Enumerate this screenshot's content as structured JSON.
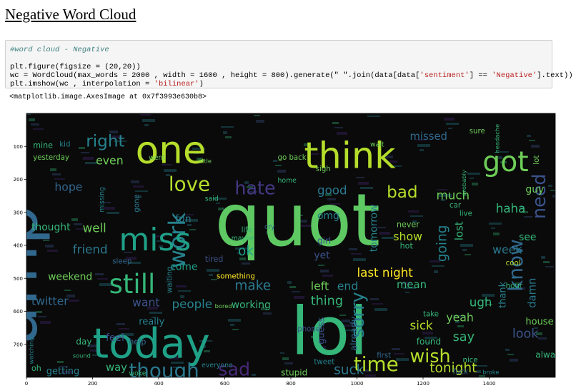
{
  "notebook": {
    "title": "Negative Word Cloud",
    "code_lines": [
      {
        "kind": "comment",
        "parts": [
          {
            "t": "#word cloud - Negative",
            "c": "comment"
          }
        ]
      },
      {
        "kind": "blank",
        "parts": [
          {
            "t": "",
            "c": ""
          }
        ]
      },
      {
        "kind": "code",
        "parts": [
          {
            "t": "plt.figure(figsize = (20,20))",
            "c": ""
          }
        ]
      },
      {
        "kind": "code",
        "parts": [
          {
            "t": "wc = WordCloud(max_words = 2000 , width = 1600 , height = 800).generate(\" \".join(data[data[",
            "c": ""
          },
          {
            "t": "'sentiment'",
            "c": "str"
          },
          {
            "t": "] == ",
            "c": ""
          },
          {
            "t": "'Negative'",
            "c": "str"
          },
          {
            "t": "].text))",
            "c": ""
          }
        ]
      },
      {
        "kind": "code",
        "parts": [
          {
            "t": "plt.imshow(wc , interpolation = ",
            "c": ""
          },
          {
            "t": "'bilinear'",
            "c": "str"
          },
          {
            "t": ")",
            "c": ""
          }
        ]
      }
    ],
    "output_repr": "<matplotlib.image.AxesImage at 0x7f3993e630b8>"
  },
  "chart_data": {
    "type": "word-cloud-image",
    "x_ticks": [
      0,
      200,
      400,
      600,
      800,
      1000,
      1200,
      1400
    ],
    "y_ticks": [
      100,
      200,
      300,
      400,
      500,
      600,
      700
    ],
    "xlim": [
      0,
      1600
    ],
    "ylim": [
      800,
      0
    ],
    "background": "#0a0a0a",
    "words": [
      {
        "text": "quot",
        "x": 570,
        "y": 400,
        "size": 220,
        "color": "#5ec962",
        "rot": 0
      },
      {
        "text": "amp",
        "x": 30,
        "y": 700,
        "size": 190,
        "color": "#31688e",
        "rot": -90
      },
      {
        "text": "lol",
        "x": 800,
        "y": 730,
        "size": 200,
        "color": "#35b779",
        "rot": 0
      },
      {
        "text": "one",
        "x": 330,
        "y": 150,
        "size": 115,
        "color": "#b5de2b",
        "rot": 0
      },
      {
        "text": "think",
        "x": 840,
        "y": 165,
        "size": 110,
        "color": "#b5de2b",
        "rot": 0
      },
      {
        "text": "today",
        "x": 200,
        "y": 740,
        "size": 125,
        "color": "#1fa187",
        "rot": 0
      },
      {
        "text": "got",
        "x": 1380,
        "y": 175,
        "size": 85,
        "color": "#6ece58",
        "rot": 0
      },
      {
        "text": "work",
        "x": 480,
        "y": 470,
        "size": 70,
        "color": "#26828e",
        "rot": -90
      },
      {
        "text": "miss",
        "x": 280,
        "y": 415,
        "size": 95,
        "color": "#1fa187",
        "rot": 0
      },
      {
        "text": "still",
        "x": 250,
        "y": 545,
        "size": 80,
        "color": "#35b779",
        "rot": 0
      },
      {
        "text": "love",
        "x": 430,
        "y": 235,
        "size": 60,
        "color": "#b5de2b",
        "rot": 0
      },
      {
        "text": "hate",
        "x": 630,
        "y": 245,
        "size": 55,
        "color": "#443983",
        "rot": 0
      },
      {
        "text": "though",
        "x": 310,
        "y": 800,
        "size": 60,
        "color": "#2a788e",
        "rot": 0
      },
      {
        "text": "sad",
        "x": 580,
        "y": 795,
        "size": 55,
        "color": "#482878",
        "rot": 0
      },
      {
        "text": "time",
        "x": 990,
        "y": 780,
        "size": 60,
        "color": "#b5de2b",
        "rot": 0
      },
      {
        "text": "wish",
        "x": 1160,
        "y": 755,
        "size": 55,
        "color": "#b5de2b",
        "rot": 0
      },
      {
        "text": "know",
        "x": 1500,
        "y": 540,
        "size": 60,
        "color": "#31688e",
        "rot": -90
      },
      {
        "text": "need",
        "x": 1570,
        "y": 320,
        "size": 55,
        "color": "#3b528b",
        "rot": -90
      },
      {
        "text": "bad",
        "x": 1090,
        "y": 255,
        "size": 50,
        "color": "#b5de2b",
        "rot": 0
      },
      {
        "text": "right",
        "x": 180,
        "y": 100,
        "size": 50,
        "color": "#26828e",
        "rot": 0
      },
      {
        "text": "sorry",
        "x": 1020,
        "y": 680,
        "size": 55,
        "color": "#26828e",
        "rot": -90
      },
      {
        "text": "last night",
        "x": 1000,
        "y": 495,
        "size": 36,
        "color": "#fde725",
        "rot": 0
      },
      {
        "text": "tonight",
        "x": 1220,
        "y": 785,
        "size": 40,
        "color": "#b5de2b",
        "rot": 0
      },
      {
        "text": "suck",
        "x": 930,
        "y": 790,
        "size": 40,
        "color": "#2a788e",
        "rot": 0
      },
      {
        "text": "good",
        "x": 880,
        "y": 245,
        "size": 36,
        "color": "#2a788e",
        "rot": 0
      },
      {
        "text": "much",
        "x": 1240,
        "y": 260,
        "size": 36,
        "color": "#6ece58",
        "rot": 0
      },
      {
        "text": "haha",
        "x": 1420,
        "y": 300,
        "size": 36,
        "color": "#35b779",
        "rot": 0
      },
      {
        "text": "well",
        "x": 170,
        "y": 360,
        "size": 36,
        "color": "#6ece58",
        "rot": 0
      },
      {
        "text": "friend",
        "x": 140,
        "y": 425,
        "size": 36,
        "color": "#2a788e",
        "rot": 0
      },
      {
        "text": "weekend",
        "x": 65,
        "y": 505,
        "size": 30,
        "color": "#6ece58",
        "rot": 0
      },
      {
        "text": "twitter",
        "x": 15,
        "y": 580,
        "size": 34,
        "color": "#31688e",
        "rot": 0
      },
      {
        "text": "people",
        "x": 440,
        "y": 590,
        "size": 36,
        "color": "#26828e",
        "rot": 0
      },
      {
        "text": "make",
        "x": 630,
        "y": 535,
        "size": 40,
        "color": "#2a788e",
        "rot": 0
      },
      {
        "text": "ok",
        "x": 640,
        "y": 430,
        "size": 40,
        "color": "#1fa187",
        "rot": 0
      },
      {
        "text": "want",
        "x": 320,
        "y": 585,
        "size": 34,
        "color": "#3b528b",
        "rot": 0
      },
      {
        "text": "working",
        "x": 620,
        "y": 590,
        "size": 30,
        "color": "#35b779",
        "rot": 0
      },
      {
        "text": "thing",
        "x": 860,
        "y": 580,
        "size": 38,
        "color": "#35b779",
        "rot": 0
      },
      {
        "text": "left",
        "x": 860,
        "y": 535,
        "size": 34,
        "color": "#6ece58",
        "rot": 0
      },
      {
        "text": "end",
        "x": 940,
        "y": 535,
        "size": 34,
        "color": "#26828e",
        "rot": 0
      },
      {
        "text": "show",
        "x": 1110,
        "y": 385,
        "size": 34,
        "color": "#b5de2b",
        "rot": 0
      },
      {
        "text": "going",
        "x": 1270,
        "y": 450,
        "size": 40,
        "color": "#26828e",
        "rot": -90
      },
      {
        "text": "lost",
        "x": 1320,
        "y": 385,
        "size": 32,
        "color": "#35b779",
        "rot": -90
      },
      {
        "text": "tomorrow",
        "x": 1060,
        "y": 420,
        "size": 30,
        "color": "#26828e",
        "rot": -90
      },
      {
        "text": "look",
        "x": 1470,
        "y": 680,
        "size": 38,
        "color": "#3b528b",
        "rot": 0
      },
      {
        "text": "say",
        "x": 1290,
        "y": 690,
        "size": 38,
        "color": "#35b779",
        "rot": 0
      },
      {
        "text": "yeah",
        "x": 1270,
        "y": 630,
        "size": 34,
        "color": "#6ece58",
        "rot": 0
      },
      {
        "text": "sick",
        "x": 1160,
        "y": 655,
        "size": 36,
        "color": "#b5de2b",
        "rot": 0
      },
      {
        "text": "ugh",
        "x": 1340,
        "y": 585,
        "size": 36,
        "color": "#35b779",
        "rot": 0
      },
      {
        "text": "mean",
        "x": 1120,
        "y": 530,
        "size": 32,
        "color": "#35b779",
        "rot": 0
      },
      {
        "text": "guy",
        "x": 1510,
        "y": 240,
        "size": 30,
        "color": "#6ece58",
        "rot": 0
      },
      {
        "text": "week",
        "x": 1410,
        "y": 425,
        "size": 34,
        "color": "#2a788e",
        "rot": 0
      },
      {
        "text": "damn",
        "x": 1540,
        "y": 590,
        "size": 32,
        "color": "#2a788e",
        "rot": -90
      },
      {
        "text": "house",
        "x": 1510,
        "y": 640,
        "size": 28,
        "color": "#6ece58",
        "rot": 0
      },
      {
        "text": "even",
        "x": 210,
        "y": 155,
        "size": 34,
        "color": "#6ece58",
        "rot": 0
      },
      {
        "text": "hope",
        "x": 85,
        "y": 235,
        "size": 34,
        "color": "#31688e",
        "rot": 0
      },
      {
        "text": "thought",
        "x": 15,
        "y": 355,
        "size": 30,
        "color": "#35b779",
        "rot": 0
      },
      {
        "text": "missed",
        "x": 1160,
        "y": 80,
        "size": 32,
        "color": "#31688e",
        "rot": 0
      },
      {
        "text": "way",
        "x": 240,
        "y": 780,
        "size": 32,
        "color": "#35b779",
        "rot": 0
      },
      {
        "text": "getting",
        "x": 60,
        "y": 790,
        "size": 28,
        "color": "#26828e",
        "rot": 0
      },
      {
        "text": "stupid",
        "x": 770,
        "y": 795,
        "size": 26,
        "color": "#6ece58",
        "rot": 0
      },
      {
        "text": "really",
        "x": 340,
        "y": 640,
        "size": 28,
        "color": "#26828e",
        "rot": 0
      },
      {
        "text": "guess",
        "x": 900,
        "y": 700,
        "size": 28,
        "color": "#3b528b",
        "rot": -90
      },
      {
        "text": "already",
        "x": 1000,
        "y": 720,
        "size": 28,
        "color": "#31688e",
        "rot": -90
      },
      {
        "text": "found",
        "x": 1180,
        "y": 700,
        "size": 26,
        "color": "#35b779",
        "rot": 0
      },
      {
        "text": "feel",
        "x": 240,
        "y": 690,
        "size": 30,
        "color": "#3b528b",
        "rot": 0
      },
      {
        "text": "come",
        "x": 435,
        "y": 475,
        "size": 30,
        "color": "#1fa187",
        "rot": 0
      },
      {
        "text": "something",
        "x": 575,
        "y": 500,
        "size": 22,
        "color": "#fde725",
        "rot": 0
      },
      {
        "text": "see",
        "x": 1490,
        "y": 385,
        "size": 30,
        "color": "#35b779",
        "rot": 0
      },
      {
        "text": "alway",
        "x": 1540,
        "y": 740,
        "size": 26,
        "color": "#35b779",
        "rot": 0
      },
      {
        "text": "thank",
        "x": 1450,
        "y": 590,
        "size": 28,
        "color": "#26828e",
        "rot": -90
      },
      {
        "text": "fun",
        "x": 450,
        "y": 330,
        "size": 30,
        "color": "#2a788e",
        "rot": 0
      },
      {
        "text": "waiting",
        "x": 440,
        "y": 545,
        "size": 22,
        "color": "#26828e",
        "rot": -90
      },
      {
        "text": "day",
        "x": 150,
        "y": 700,
        "size": 26,
        "color": "#35b779",
        "rot": 0
      },
      {
        "text": "sound",
        "x": 140,
        "y": 740,
        "size": 18,
        "color": "#35b779",
        "rot": 0
      },
      {
        "text": "yesterday",
        "x": 20,
        "y": 140,
        "size": 22,
        "color": "#6ece58",
        "rot": 0
      },
      {
        "text": "mine",
        "x": 20,
        "y": 105,
        "size": 24,
        "color": "#35b779",
        "rot": 0
      },
      {
        "text": "kid",
        "x": 100,
        "y": 100,
        "size": 22,
        "color": "#26828e",
        "rot": 0
      },
      {
        "text": "omg",
        "x": 880,
        "y": 320,
        "size": 30,
        "color": "#26828e",
        "rot": 0
      },
      {
        "text": "girl",
        "x": 880,
        "y": 395,
        "size": 26,
        "color": "#3b528b",
        "rot": 0
      },
      {
        "text": "yet",
        "x": 870,
        "y": 440,
        "size": 30,
        "color": "#3b528b",
        "rot": 0
      },
      {
        "text": "never",
        "x": 1120,
        "y": 345,
        "size": 24,
        "color": "#6ece58",
        "rot": 0
      },
      {
        "text": "hot",
        "x": 1130,
        "y": 410,
        "size": 24,
        "color": "#35b779",
        "rot": 0
      },
      {
        "text": "cool",
        "x": 1450,
        "y": 460,
        "size": 22,
        "color": "#b5de2b",
        "rot": 0
      },
      {
        "text": "go back",
        "x": 760,
        "y": 140,
        "size": 22,
        "color": "#6ece58",
        "rot": 0
      },
      {
        "text": "sigh",
        "x": 875,
        "y": 175,
        "size": 22,
        "color": "#6ece58",
        "rot": 0
      },
      {
        "text": "gone",
        "x": 340,
        "y": 300,
        "size": 22,
        "color": "#2a788e",
        "rot": -90
      },
      {
        "text": "missing",
        "x": 235,
        "y": 300,
        "size": 20,
        "color": "#26828e",
        "rot": -90
      },
      {
        "text": "tired",
        "x": 540,
        "y": 450,
        "size": 24,
        "color": "#3b528b",
        "rot": 0
      },
      {
        "text": "live",
        "x": 1310,
        "y": 310,
        "size": 22,
        "color": "#35b779",
        "rot": 0
      },
      {
        "text": "car",
        "x": 1280,
        "y": 285,
        "size": 22,
        "color": "#35b779",
        "rot": 0
      },
      {
        "text": "wait",
        "x": 1040,
        "y": 100,
        "size": 20,
        "color": "#6ece58",
        "rot": 0
      },
      {
        "text": "sure",
        "x": 1340,
        "y": 60,
        "size": 22,
        "color": "#6ece58",
        "rot": 0
      },
      {
        "text": "probably",
        "x": 1330,
        "y": 250,
        "size": 18,
        "color": "#35b779",
        "rot": -90
      },
      {
        "text": "sleep",
        "x": 260,
        "y": 455,
        "size": 22,
        "color": "#31688e",
        "rot": 0
      },
      {
        "text": "life",
        "x": 650,
        "y": 360,
        "size": 22,
        "color": "#35b779",
        "rot": 0
      },
      {
        "text": "maybe",
        "x": 620,
        "y": 385,
        "size": 20,
        "color": "#35b779",
        "rot": 0
      },
      {
        "text": "bored",
        "x": 570,
        "y": 590,
        "size": 18,
        "color": "#6ece58",
        "rot": 0
      },
      {
        "text": "hour",
        "x": 1450,
        "y": 530,
        "size": 22,
        "color": "#35b779",
        "rot": 0
      },
      {
        "text": "take",
        "x": 1200,
        "y": 615,
        "size": 22,
        "color": "#35b779",
        "rot": 0
      },
      {
        "text": "first",
        "x": 1060,
        "y": 740,
        "size": 22,
        "color": "#31688e",
        "rot": 0
      },
      {
        "text": "fuck",
        "x": 1290,
        "y": 790,
        "size": 22,
        "color": "#31688e",
        "rot": 0
      },
      {
        "text": "tweet",
        "x": 870,
        "y": 760,
        "size": 22,
        "color": "#26828e",
        "rot": 0
      },
      {
        "text": "help",
        "x": 310,
        "y": 700,
        "size": 24,
        "color": "#31688e",
        "rot": 0
      },
      {
        "text": "oh",
        "x": 15,
        "y": 780,
        "size": 24,
        "color": "#35b779",
        "rot": 0
      },
      {
        "text": "watching",
        "x": 20,
        "y": 760,
        "size": 18,
        "color": "#26828e",
        "rot": -90
      },
      {
        "text": "woke",
        "x": 310,
        "y": 795,
        "size": 20,
        "color": "#35b779",
        "rot": 0
      },
      {
        "text": "home",
        "x": 760,
        "y": 210,
        "size": 20,
        "color": "#35b779",
        "rot": 0
      },
      {
        "text": "said",
        "x": 540,
        "y": 265,
        "size": 20,
        "color": "#35b779",
        "rot": 0
      },
      {
        "text": "little",
        "x": 520,
        "y": 150,
        "size": 18,
        "color": "#6ece58",
        "rot": 0
      },
      {
        "text": "went",
        "x": 370,
        "y": 140,
        "size": 20,
        "color": "#6ece58",
        "rot": 0
      },
      {
        "text": "phone",
        "x": 820,
        "y": 660,
        "size": 22,
        "color": "#3b528b",
        "rot": 0
      },
      {
        "text": "cry",
        "x": 720,
        "y": 350,
        "size": 20,
        "color": "#31688e",
        "rot": 0
      },
      {
        "text": "everyone",
        "x": 530,
        "y": 770,
        "size": 20,
        "color": "#26828e",
        "rot": 0
      },
      {
        "text": "nice",
        "x": 1320,
        "y": 755,
        "size": 22,
        "color": "#35b779",
        "rot": 0
      },
      {
        "text": "broke",
        "x": 1380,
        "y": 790,
        "size": 18,
        "color": "#26828e",
        "rot": 0
      },
      {
        "text": "headache",
        "x": 1430,
        "y": 120,
        "size": 18,
        "color": "#35b779",
        "rot": -90
      },
      {
        "text": "lot",
        "x": 1550,
        "y": 155,
        "size": 22,
        "color": "#6ece58",
        "rot": -90
      }
    ]
  }
}
